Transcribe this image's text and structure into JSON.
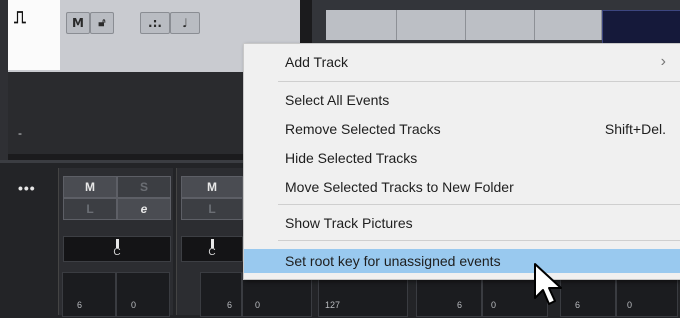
{
  "track": {
    "mute_label": "M",
    "timebase_label": ".:.",
    "note_label": "♩",
    "name_placeholder": "-"
  },
  "mixer": {
    "more_label": "•••",
    "strip1": {
      "mute": "M",
      "solo": "S",
      "listen": "L",
      "edit": "e",
      "pan": "C",
      "fader_left": "6",
      "fader_right": "0"
    },
    "strip2": {
      "mute": "M",
      "listen": "L",
      "pan": "C",
      "fader_left": "6",
      "fader_right": "0"
    },
    "strip3": {
      "value": "127"
    },
    "strip4": {
      "fader_left": "6",
      "fader_right": "0"
    },
    "strip5": {
      "fader_left": "6",
      "fader_right": "0"
    }
  },
  "context_menu": {
    "items": [
      {
        "label": "Add Track",
        "submenu": true
      },
      {
        "label": "Select All Events"
      },
      {
        "label": "Remove Selected Tracks",
        "shortcut": "Shift+Del."
      },
      {
        "label": "Hide Selected Tracks"
      },
      {
        "label": "Move Selected Tracks to New Folder"
      },
      {
        "label": "Show Track Pictures"
      },
      {
        "label": "Set root key for unassigned events",
        "highlighted": true
      }
    ],
    "submenu_arrow": "›"
  },
  "colors": {
    "highlight": "#99c9ef",
    "menu_bg": "#f0f0f0",
    "event_blue": "#15193a"
  }
}
